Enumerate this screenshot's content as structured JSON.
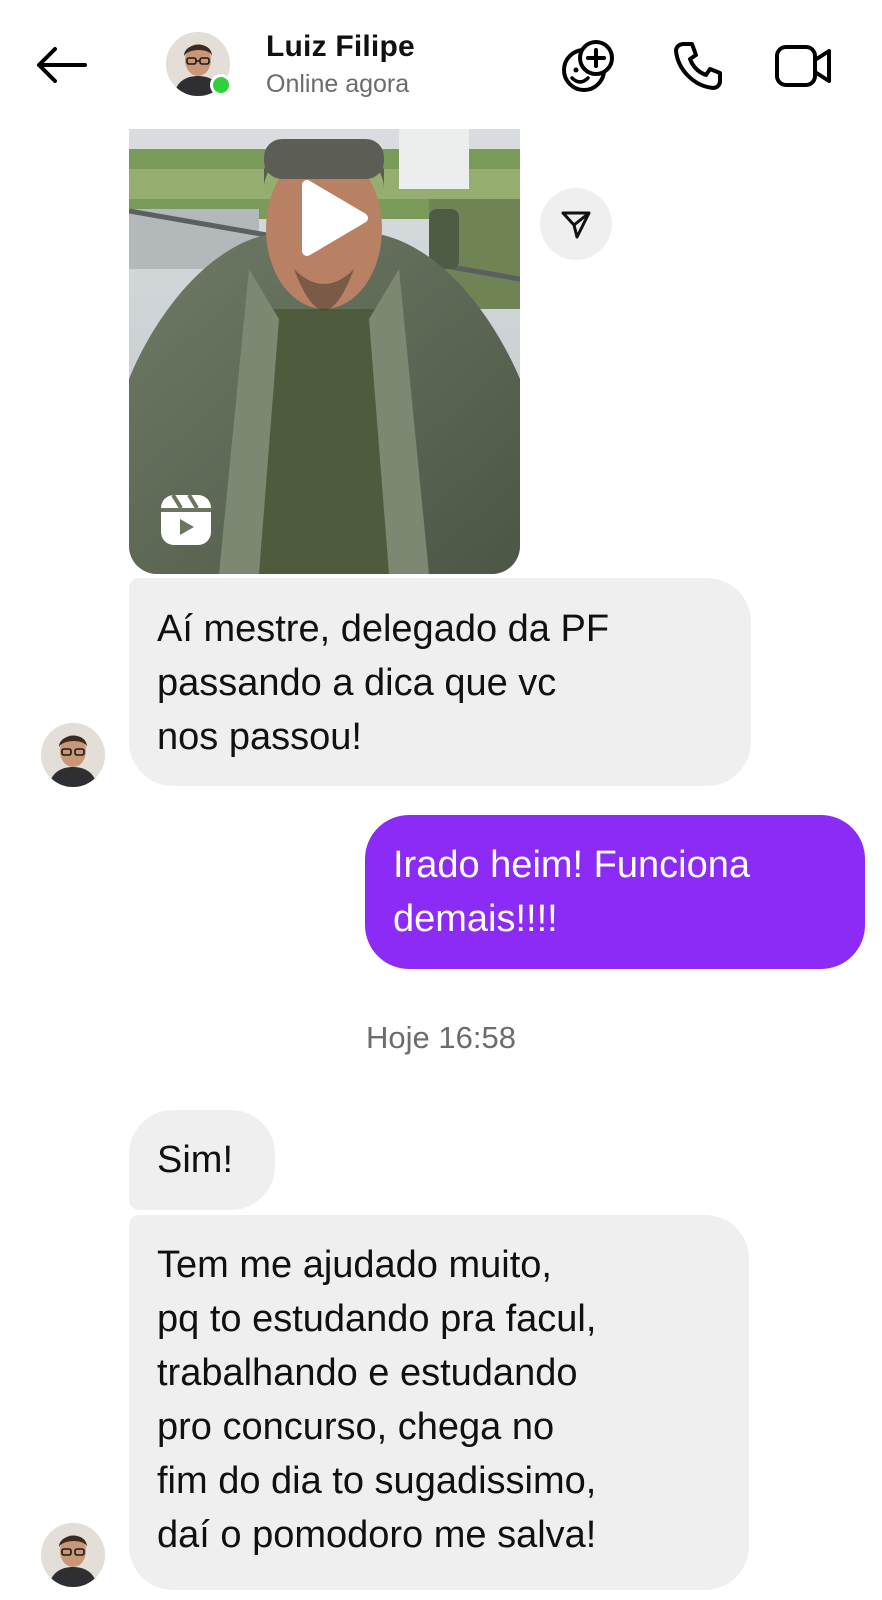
{
  "header": {
    "contact_name": "Luiz Filipe",
    "status": "Online agora",
    "icons": {
      "back": "arrow-left-icon",
      "effects": "smiley-plus-icon",
      "call": "phone-icon",
      "video": "video-camera-icon"
    },
    "online_color": "#2fd13a"
  },
  "messages": [
    {
      "direction": "incoming",
      "type": "reel",
      "icons": [
        "play-icon",
        "reels-icon",
        "share-icon"
      ]
    },
    {
      "direction": "incoming",
      "lines": [
        "Aí mestre, delegado da PF",
        "passando a dica que vc",
        "nos passou!"
      ]
    },
    {
      "direction": "outgoing",
      "lines": [
        "Irado heim! Funciona",
        "demais!!!!"
      ]
    },
    {
      "direction": "incoming",
      "lines": [
        "Sim!"
      ]
    },
    {
      "direction": "incoming",
      "lines": [
        "Tem me ajudado muito,",
        "pq to estudando pra facul,",
        "trabalhando e estudando",
        "pro concurso, chega no",
        "fim do dia to sugadissimo,",
        "daí o pomodoro me salva!"
      ]
    }
  ],
  "timestamp": "Hoje 16:58",
  "colors": {
    "outgoing_bubble": "#8b2bf5",
    "incoming_bubble": "#efefef"
  }
}
